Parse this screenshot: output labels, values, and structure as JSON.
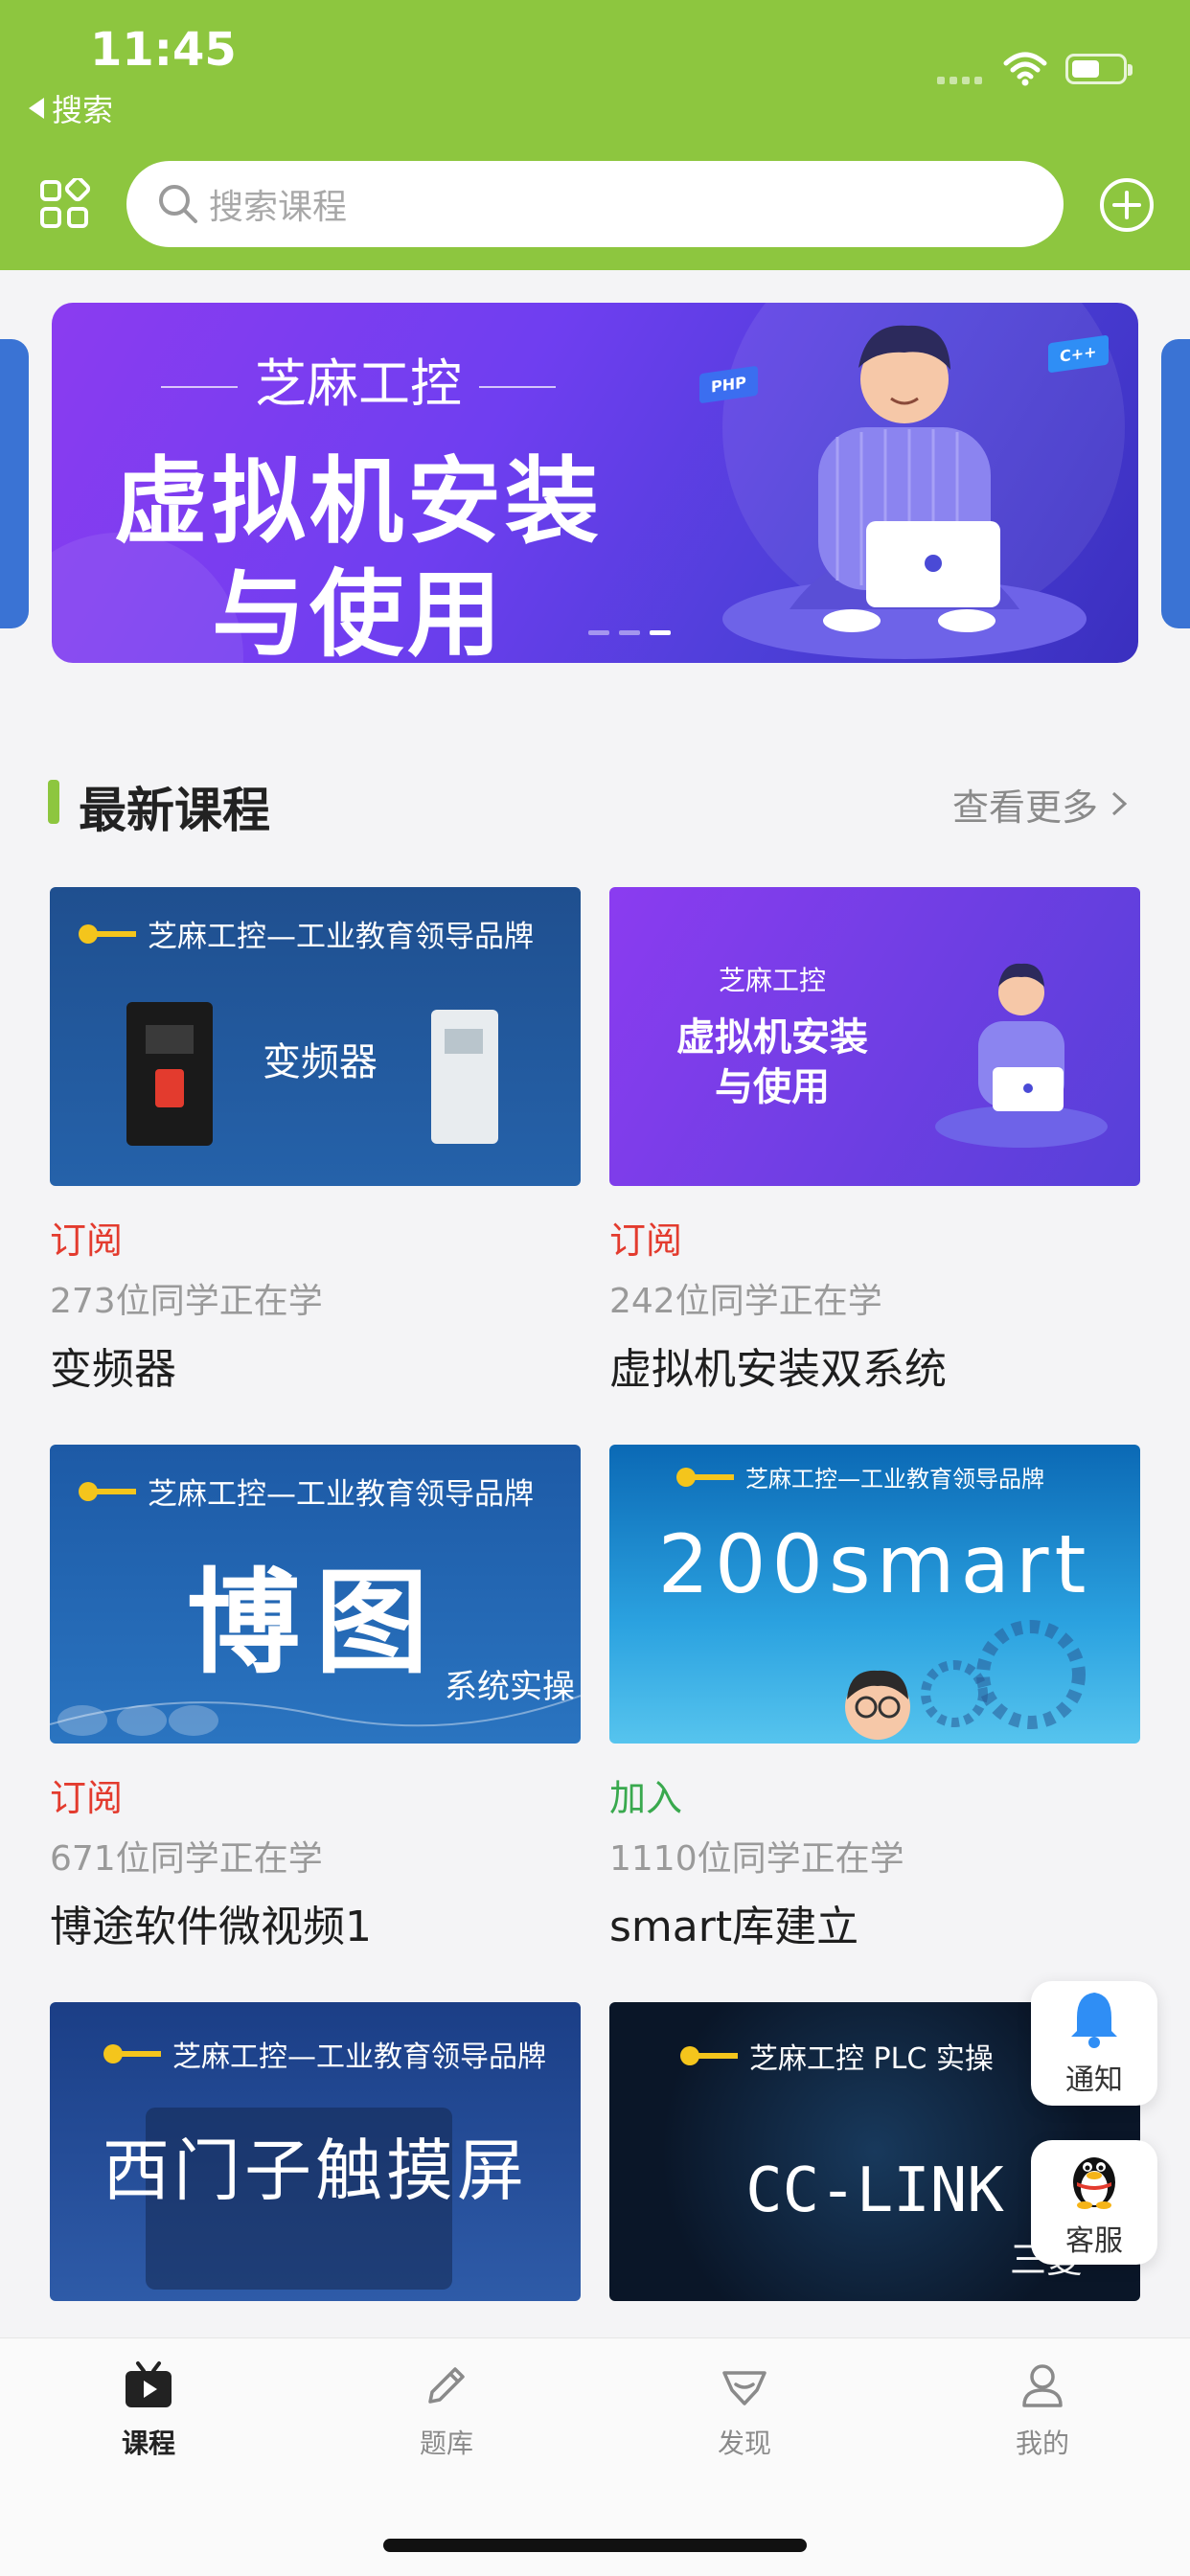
{
  "status_bar": {
    "time": "11:45",
    "back_label": "搜索"
  },
  "header": {
    "search_placeholder": "搜索课程"
  },
  "banner": {
    "brand": "芝麻工控",
    "title_line1": "虚拟机安装",
    "title_line2": "与使用",
    "tag_php": "PHP",
    "tag_cpp": "C++"
  },
  "section": {
    "title": "最新课程",
    "more_label": "查看更多"
  },
  "courses": [
    {
      "status": "订阅",
      "learners": "273位同学正在学",
      "title": "变频器",
      "thumb_brand": "芝麻工控—工业教育领导品牌",
      "thumb_text": "变频器"
    },
    {
      "status": "订阅",
      "learners": "242位同学正在学",
      "title": "虚拟机安装双系统",
      "thumb_brand": "芝麻工控",
      "thumb_text1": "虚拟机安装",
      "thumb_text2": "与使用"
    },
    {
      "status": "订阅",
      "learners": "671位同学正在学",
      "title": "博途软件微视频1",
      "thumb_brand": "芝麻工控—工业教育领导品牌",
      "thumb_text": "博图",
      "thumb_sub": "系统实操"
    },
    {
      "status": "加入",
      "learners": "1110位同学正在学",
      "title": "smart库建立",
      "thumb_brand": "芝麻工控—工业教育领导品牌",
      "thumb_text": "200smart"
    },
    {
      "thumb_brand": "芝麻工控—工业教育领导品牌",
      "thumb_text": "西门子触摸屏"
    },
    {
      "thumb_brand": "芝麻工控 PLC 实操",
      "thumb_text": "CC-LINK",
      "thumb_sub": "三菱"
    }
  ],
  "floating": {
    "notify_label": "通知",
    "service_label": "客服"
  },
  "tabbar": [
    {
      "label": "课程",
      "icon": "play-tv-icon",
      "active": true
    },
    {
      "label": "题库",
      "icon": "pencil-icon",
      "active": false
    },
    {
      "label": "发现",
      "icon": "diamond-icon",
      "active": false
    },
    {
      "label": "我的",
      "icon": "person-icon",
      "active": false
    }
  ],
  "colors": {
    "brand_green": "#8dc63f",
    "subscribe_red": "#e33b2e",
    "join_green": "#39a94e"
  }
}
